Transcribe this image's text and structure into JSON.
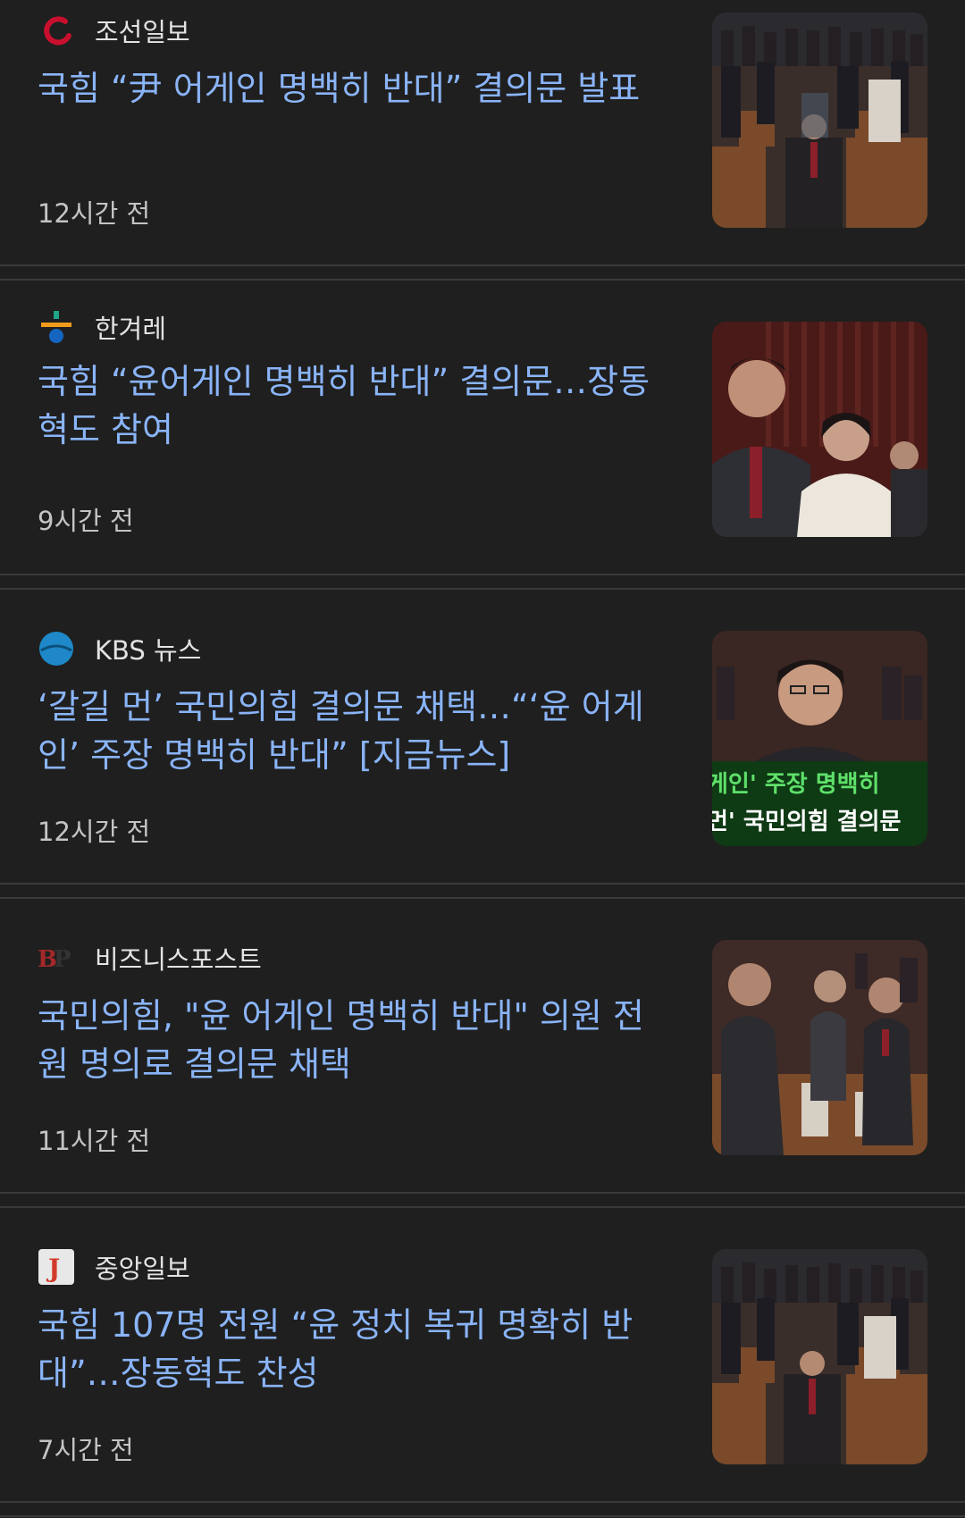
{
  "articles": [
    {
      "source": "조선일보",
      "logo_icon": "chosun-logo-icon",
      "headline": "국힘 “尹 어게인 명백히 반대” 결의문 발표",
      "time": "12시간 전"
    },
    {
      "source": "한겨레",
      "logo_icon": "hankyoreh-logo-icon",
      "headline": "국힘 “윤어게인 명백히 반대” 결의문…장동혁도 참여",
      "time": "9시간 전"
    },
    {
      "source": "KBS 뉴스",
      "logo_icon": "kbs-logo-icon",
      "headline": "‘갈길 먼’ 국민의힘 결의문 채택…“‘윤 어게인’ 주장 명백히 반대” [지금뉴스]",
      "time": "12시간 전",
      "thumb_caption_1": "게인' 주장 명백히",
      "thumb_caption_2": "먼' 국민의힘 결의문"
    },
    {
      "source": "비즈니스포스트",
      "logo_icon": "businesspost-logo-icon",
      "headline": "국민의힘, \"윤 어게인 명백히 반대\" 의원 전원 명의로 결의문 채택",
      "time": "11시간 전"
    },
    {
      "source": "중앙일보",
      "logo_icon": "joongang-logo-icon",
      "headline": "국힘 107명 전원 “윤 정치 복귀 명확히 반대”…장동혁도 찬성",
      "time": "7시간 전"
    }
  ],
  "colors": {
    "background": "#1f1f1f",
    "headline": "#8ab4f8",
    "source": "#e3e3e3",
    "time": "#c4c4c4"
  }
}
